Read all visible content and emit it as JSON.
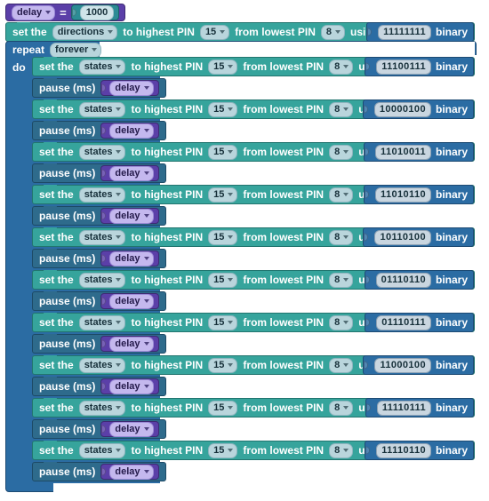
{
  "editor": {
    "name": "blockly-workspace",
    "background": "#ffffff"
  },
  "colors": {
    "variable_purple": "#5b3fa8",
    "statement_teal": "#36a49c",
    "statement_dark_blue": "#2e6b8c",
    "loop_blue": "#2b6ca3",
    "binary_value_blue": "#2b6ca3",
    "number_value_teal": "#2c8c95",
    "field_light": "#b9d5dc"
  },
  "variable_set_block": {
    "variable": "delay",
    "operator": "=",
    "value": "1000"
  },
  "set_directions_block": {
    "prefix": "set the",
    "target": "directions",
    "highest_label": "to highest PIN",
    "highest_pin": "15",
    "lowest_label": "from lowest PIN",
    "lowest_pin": "8",
    "bits_label": "using bits from",
    "bits_value": "11111111",
    "bits_suffix": "binary"
  },
  "repeat_block": {
    "keyword": "repeat",
    "mode": "forever",
    "do_label": "do"
  },
  "labels": {
    "set_prefix": "set the",
    "states_target": "states",
    "highest_label": "to highest PIN",
    "highest_pin": "15",
    "lowest_label": "from lowest PIN",
    "lowest_pin": "8",
    "bits_label": "using bits from",
    "bits_suffix": "binary",
    "pause_label": "pause (ms)",
    "pause_value": "delay"
  },
  "loop_body": [
    {
      "type": "set_states",
      "bits_value": "11100111"
    },
    {
      "type": "pause",
      "value": "delay"
    },
    {
      "type": "set_states",
      "bits_value": "10000100"
    },
    {
      "type": "pause",
      "value": "delay"
    },
    {
      "type": "set_states",
      "bits_value": "11010011"
    },
    {
      "type": "pause",
      "value": "delay"
    },
    {
      "type": "set_states",
      "bits_value": "11010110"
    },
    {
      "type": "pause",
      "value": "delay"
    },
    {
      "type": "set_states",
      "bits_value": "10110100"
    },
    {
      "type": "pause",
      "value": "delay"
    },
    {
      "type": "set_states",
      "bits_value": "01110110"
    },
    {
      "type": "pause",
      "value": "delay"
    },
    {
      "type": "set_states",
      "bits_value": "01110111"
    },
    {
      "type": "pause",
      "value": "delay"
    },
    {
      "type": "set_states",
      "bits_value": "11000100"
    },
    {
      "type": "pause",
      "value": "delay"
    },
    {
      "type": "set_states",
      "bits_value": "11110111"
    },
    {
      "type": "pause",
      "value": "delay"
    },
    {
      "type": "set_states",
      "bits_value": "11110110"
    },
    {
      "type": "pause",
      "value": "delay"
    }
  ]
}
